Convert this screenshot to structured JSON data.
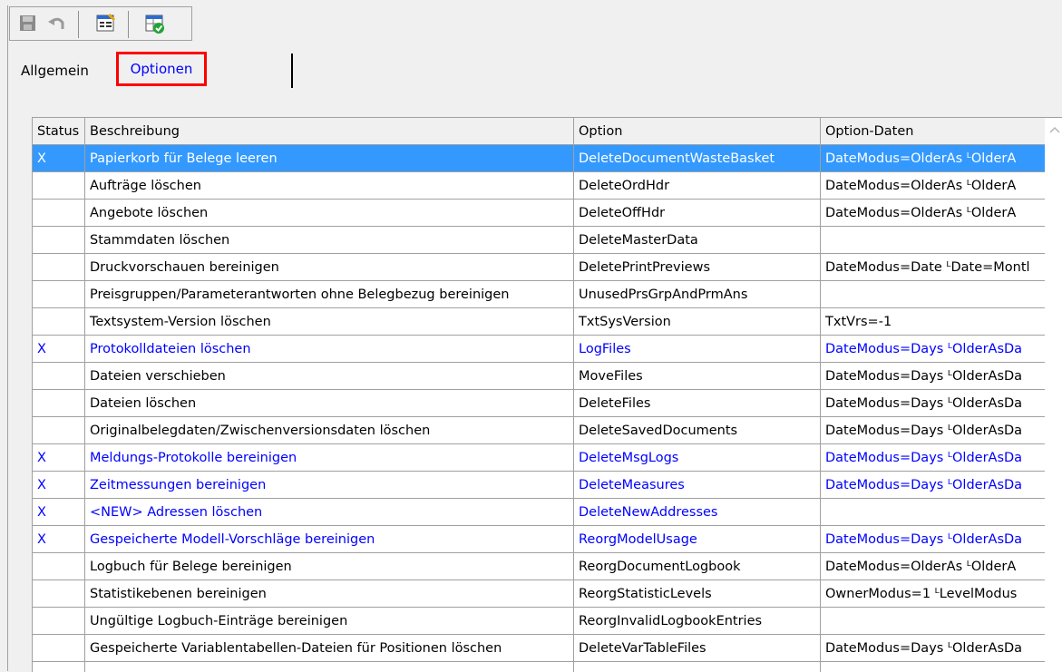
{
  "toolbar": {
    "icons": [
      "save-icon",
      "undo-icon",
      "properties-icon",
      "check-table-icon"
    ]
  },
  "tabs": [
    {
      "label": "Allgemein"
    },
    {
      "label": "Optionen"
    }
  ],
  "table": {
    "headers": {
      "status": "Status",
      "beschreibung": "Beschreibung",
      "option": "Option",
      "daten": "Option-Daten"
    },
    "rows": [
      {
        "status": "X",
        "beschreibung": "Papierkorb für Belege leeren",
        "option": "DeleteDocumentWasteBasket",
        "daten": "DateModus=OlderAs ᴸOlderA"
      },
      {
        "status": "",
        "beschreibung": "Aufträge löschen",
        "option": "DeleteOrdHdr",
        "daten": "DateModus=OlderAs ᴸOlderA"
      },
      {
        "status": "",
        "beschreibung": "Angebote löschen",
        "option": "DeleteOffHdr",
        "daten": "DateModus=OlderAs ᴸOlderA"
      },
      {
        "status": "",
        "beschreibung": "Stammdaten löschen",
        "option": "DeleteMasterData",
        "daten": ""
      },
      {
        "status": "",
        "beschreibung": "Druckvorschauen bereinigen",
        "option": "DeletePrintPreviews",
        "daten": "DateModus=Date ᴸDate=Montl"
      },
      {
        "status": "",
        "beschreibung": "Preisgruppen/Parameterantworten ohne Belegbezug bereinigen",
        "option": "UnusedPrsGrpAndPrmAns",
        "daten": ""
      },
      {
        "status": "",
        "beschreibung": "Textsystem-Version löschen",
        "option": "TxtSysVersion",
        "daten": "TxtVrs=-1"
      },
      {
        "status": "X",
        "beschreibung": "Protokolldateien löschen",
        "option": "LogFiles",
        "daten": "DateModus=Days ᴸOlderAsDa"
      },
      {
        "status": "",
        "beschreibung": "Dateien verschieben",
        "option": "MoveFiles",
        "daten": "DateModus=Days ᴸOlderAsDa"
      },
      {
        "status": "",
        "beschreibung": "Dateien löschen",
        "option": "DeleteFiles",
        "daten": "DateModus=Days ᴸOlderAsDa"
      },
      {
        "status": "",
        "beschreibung": "Originalbelegdaten/Zwischenversionsdaten löschen",
        "option": "DeleteSavedDocuments",
        "daten": "DateModus=Days ᴸOlderAsDa"
      },
      {
        "status": "X",
        "beschreibung": "Meldungs-Protokolle bereinigen",
        "option": "DeleteMsgLogs",
        "daten": "DateModus=Days ᴸOlderAsDa"
      },
      {
        "status": "X",
        "beschreibung": "Zeitmessungen bereinigen",
        "option": "DeleteMeasures",
        "daten": "DateModus=Days ᴸOlderAsDa"
      },
      {
        "status": "X",
        "beschreibung": "<NEW> Adressen löschen",
        "option": "DeleteNewAddresses",
        "daten": ""
      },
      {
        "status": "X",
        "beschreibung": "Gespeicherte Modell-Vorschläge bereinigen",
        "option": "ReorgModelUsage",
        "daten": "DateModus=Days ᴸOlderAsDa"
      },
      {
        "status": "",
        "beschreibung": "Logbuch für Belege bereinigen",
        "option": "ReorgDocumentLogbook",
        "daten": "DateModus=OlderAs ᴸOlderA"
      },
      {
        "status": "",
        "beschreibung": "Statistikebenen bereinigen",
        "option": "ReorgStatisticLevels",
        "daten": "OwnerModus=1 ᴸLevelModus"
      },
      {
        "status": "",
        "beschreibung": "Ungültige Logbuch-Einträge bereinigen",
        "option": "ReorgInvalidLogbookEntries",
        "daten": ""
      },
      {
        "status": "",
        "beschreibung": "Gespeicherte Variablentabellen-Dateien für Positionen löschen",
        "option": "DeleteVarTableFiles",
        "daten": "DateModus=Days ᴸOlderAsDa"
      }
    ]
  },
  "colors": {
    "selected_row_bg": "#3399ff",
    "active_row_text": "#0000ff",
    "highlight_box": "#ff0000"
  }
}
